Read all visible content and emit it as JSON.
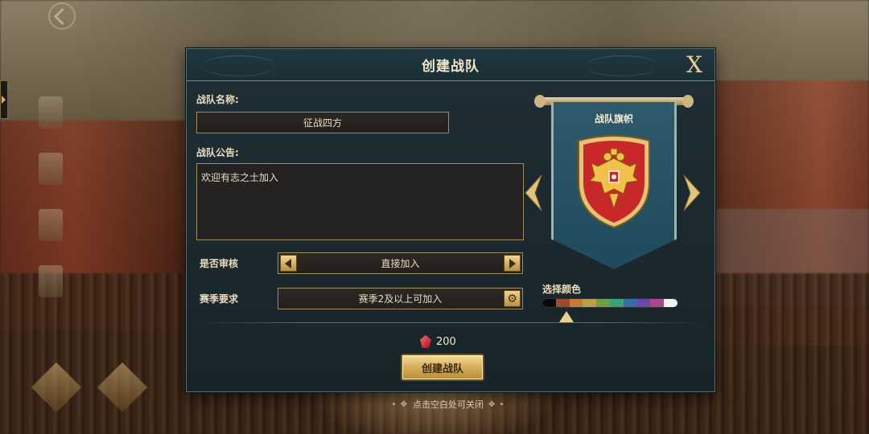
{
  "dialog": {
    "title": "创建战队",
    "close_label": "X",
    "name_label": "战队名称:",
    "name_value": "征战四方",
    "notice_label": "战队公告:",
    "notice_value": "欢迎有志之士加入",
    "review_label": "是否审核",
    "review_value": "直接加入",
    "season_label": "赛季要求",
    "season_value": "赛季2及以上可加入",
    "banner_title": "战队旗帜",
    "color_label": "选择颜色",
    "palette_colors": [
      "#0a0a0a",
      "#a14a2a",
      "#c47a3a",
      "#b9a14a",
      "#6aa04a",
      "#3aa07a",
      "#3a6aa8",
      "#6a4aa8",
      "#a84a8a",
      "#f2f2f2"
    ],
    "selected_color_index": 1,
    "cost_value": "200",
    "create_button": "创建战队"
  },
  "close_hint": "点击空白处可关闭",
  "colors": {
    "accent_gold": "#e8cf93",
    "banner_blue": "#2e5a6c",
    "shield_red": "#c9282a"
  },
  "icons": [
    "back-icon",
    "close-icon",
    "arrow-left-icon",
    "arrow-right-icon",
    "gear-icon",
    "gem-icon",
    "shield-emblem-icon"
  ]
}
